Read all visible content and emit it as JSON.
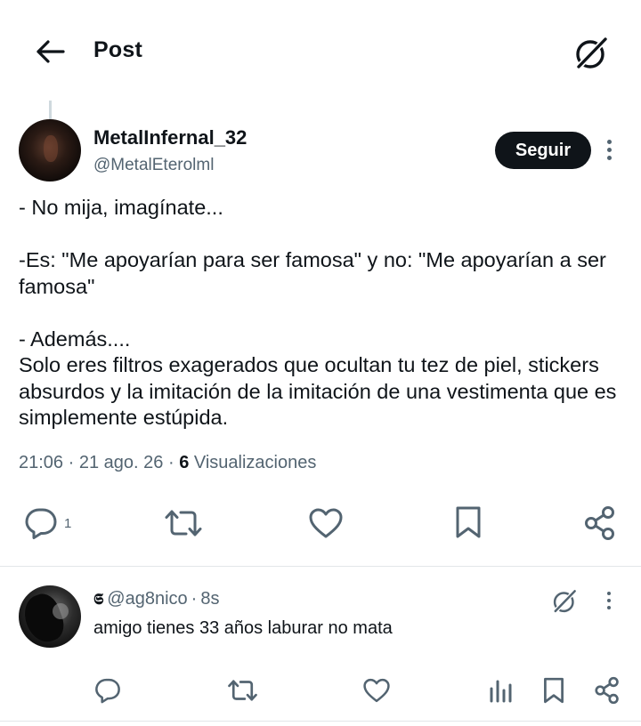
{
  "header": {
    "title": "Post",
    "back_icon": "arrow-left-icon",
    "grok_icon": "grok-icon"
  },
  "post": {
    "author_name": "MetalInfernal_32",
    "author_handle": "@MetalEterolml",
    "follow_label": "Seguir",
    "body": "- No mija, imagínate...\n\n-Es: \"Me apoyarían para ser  famosa\"  y no: \"Me apoyarían a ser famosa\"\n\n- Además....\nSolo eres filtros exagerados que ocultan tu tez de piel, stickers absurdos y la imitación de la imitación de una vestimenta que es simplemente estúpida.",
    "time": "21:06",
    "date": "21 ago. 26",
    "separator": "·",
    "views_count": "6",
    "views_label": "Visualizaciones",
    "reply_count": "1"
  },
  "reply": {
    "badge": "𝕾",
    "handle": "@ag8nico",
    "separator": "·",
    "time": "8s",
    "text": "amigo tienes 33 años laburar no mata"
  },
  "colors": {
    "text_primary": "#0f1419",
    "text_secondary": "#536471",
    "divider": "#e2e6e9",
    "follow_bg": "#0f1419"
  }
}
